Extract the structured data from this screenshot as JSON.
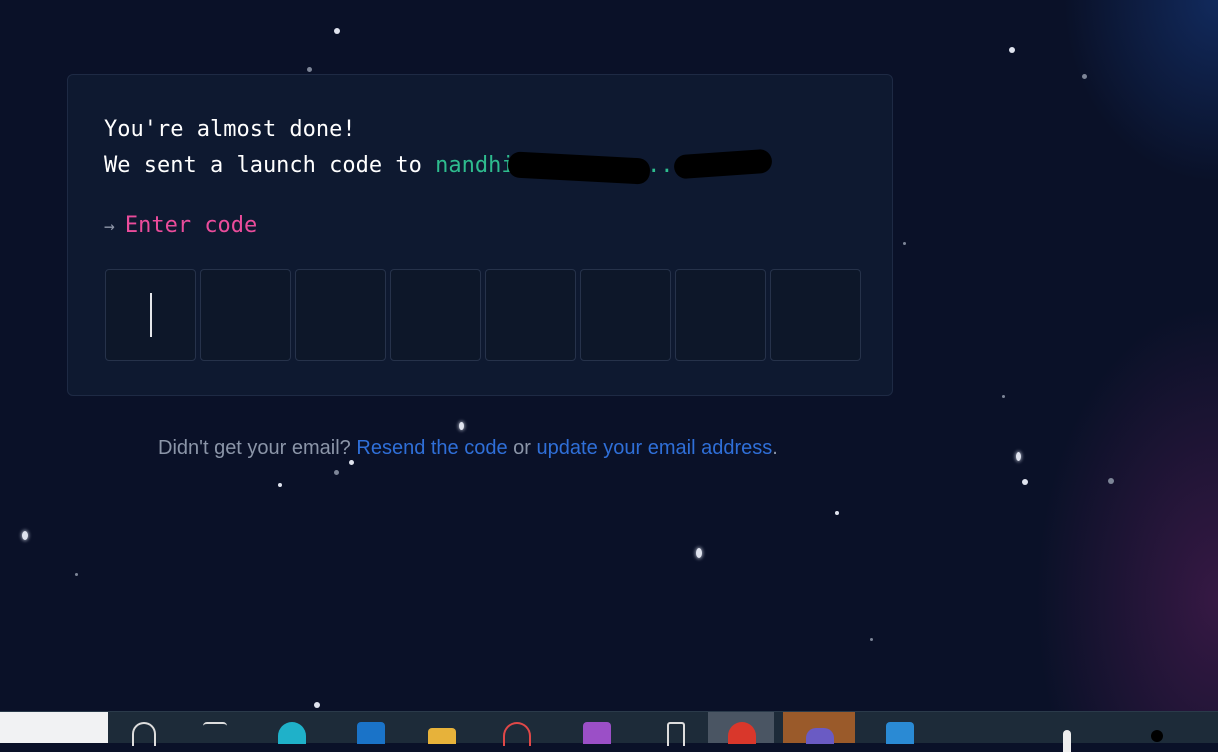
{
  "header": {
    "title": "You're almost done!",
    "sent_prefix": "We sent a launch code to ",
    "email": "nandhi.......@......com"
  },
  "code": {
    "prompt_arrow": "→",
    "prompt": "Enter code",
    "digits": [
      "",
      "",
      "",
      "",
      "",
      "",
      "",
      ""
    ]
  },
  "footer": {
    "question": "Didn't get your email?",
    "resend_link": "Resend the code",
    "or_text": "or",
    "update_link": "update your email address",
    "period": "."
  },
  "colors": {
    "background": "#0a1128",
    "card": "#0e1930",
    "email": "#2ebc8e",
    "prompt": "#ea4c9b",
    "link": "#2f6fd8"
  },
  "taskbar": {
    "icons": [
      "search-icon",
      "task-view-icon",
      "edge-icon",
      "outlook-icon",
      "file-explorer-icon",
      "snipping-tool-icon",
      "onenote-icon",
      "phone-link-icon",
      "chrome-icon",
      "teams-icon",
      "vscode-icon"
    ]
  }
}
